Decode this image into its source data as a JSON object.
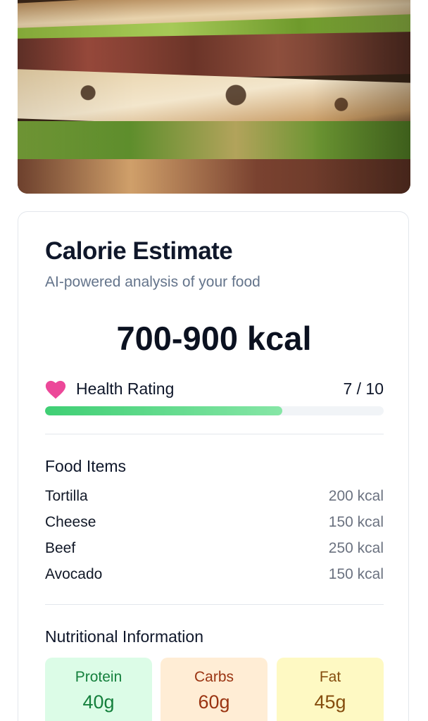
{
  "card": {
    "title": "Calorie Estimate",
    "subtitle": "AI-powered analysis of your food",
    "calories": "700-900 kcal"
  },
  "health": {
    "icon": "heart-icon",
    "label": "Health Rating",
    "score_text": "7 / 10",
    "score": 7,
    "max": 10,
    "bar_color": "#4ade80",
    "icon_color": "#ec4899"
  },
  "food_items": {
    "title": "Food Items",
    "items": [
      {
        "name": "Tortilla",
        "kcal": "200 kcal"
      },
      {
        "name": "Cheese",
        "kcal": "150 kcal"
      },
      {
        "name": "Beef",
        "kcal": "250 kcal"
      },
      {
        "name": "Avocado",
        "kcal": "150 kcal"
      }
    ]
  },
  "nutrition": {
    "title": "Nutritional Information",
    "items": [
      {
        "label": "Protein",
        "value": "40g",
        "bg": "#dcfce7",
        "color": "#15803d"
      },
      {
        "label": "Carbs",
        "value": "60g",
        "bg": "#ffedd5",
        "color": "#9a3412"
      },
      {
        "label": "Fat",
        "value": "45g",
        "bg": "#fef9c3",
        "color": "#854d0e"
      }
    ]
  }
}
